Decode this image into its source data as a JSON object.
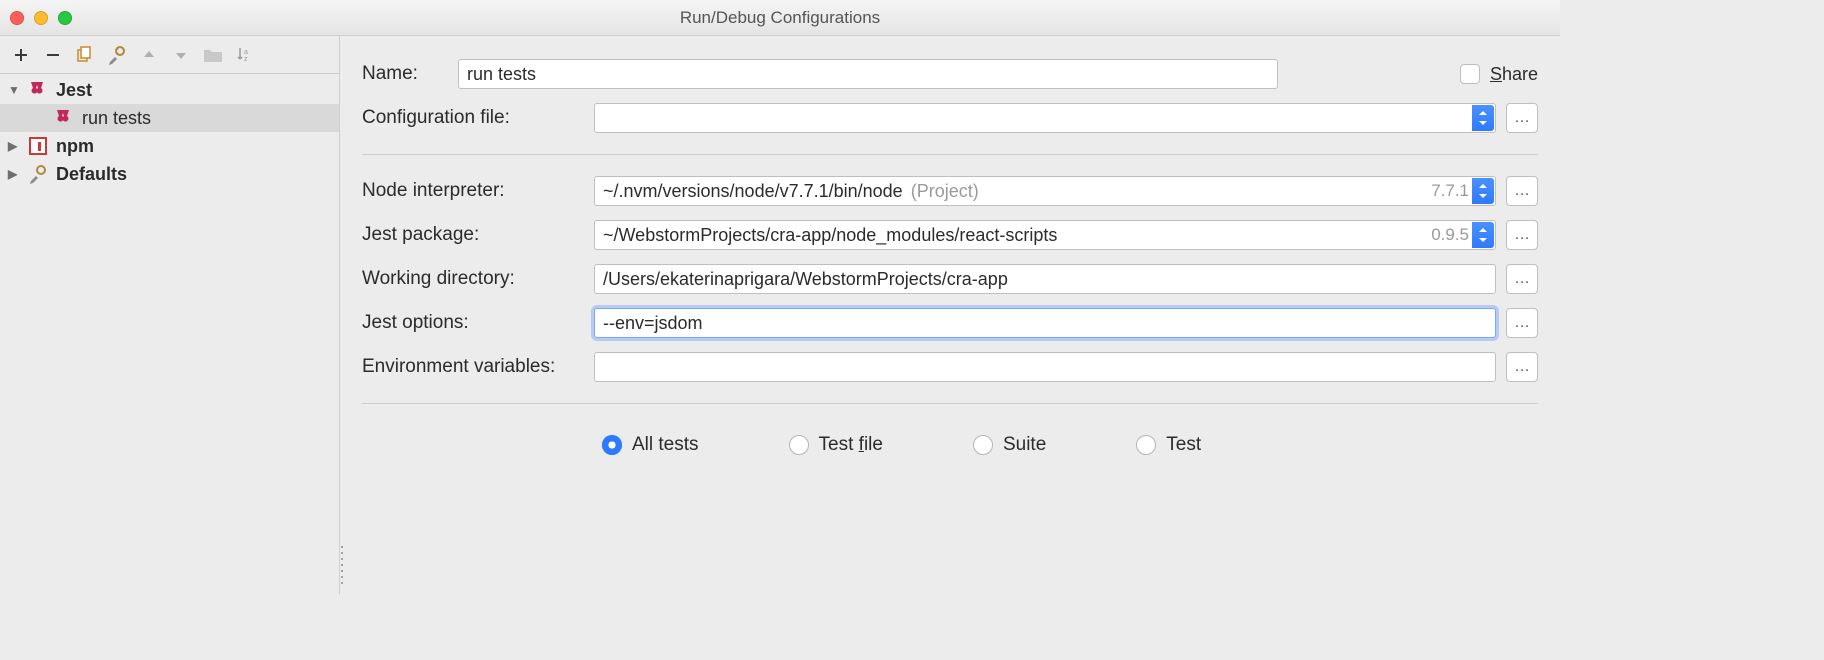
{
  "window": {
    "title": "Run/Debug Configurations"
  },
  "toolbar": {
    "items": [
      {
        "name": "add-icon",
        "kind": "plus"
      },
      {
        "name": "remove-icon",
        "kind": "minus"
      },
      {
        "name": "copy-icon",
        "kind": "copy"
      },
      {
        "name": "edit-defaults-icon",
        "kind": "wrench-gear"
      },
      {
        "name": "move-up-icon",
        "kind": "up"
      },
      {
        "name": "move-down-icon",
        "kind": "down"
      },
      {
        "name": "folder-icon",
        "kind": "folder"
      },
      {
        "name": "sort-icon",
        "kind": "sort-az"
      }
    ]
  },
  "tree": {
    "items": [
      {
        "label": "Jest",
        "icon": "jest-icon",
        "expanded": true,
        "bold": true,
        "depth": 0
      },
      {
        "label": "run tests",
        "icon": "jest-icon",
        "depth": 1,
        "selected": true
      },
      {
        "label": "npm",
        "icon": "npm-icon",
        "expanded": false,
        "bold": true,
        "depth": 0
      },
      {
        "label": "Defaults",
        "icon": "wrench-gear-icon",
        "expanded": false,
        "bold": true,
        "depth": 0
      }
    ]
  },
  "form": {
    "name_label": "Name:",
    "name_value": "run tests",
    "share_label": "Share",
    "config_file_label": "Configuration file:",
    "config_file_value": "",
    "node_interpreter_label": "Node interpreter:",
    "node_interpreter_value": "~/.nvm/versions/node/v7.7.1/bin/node",
    "node_interpreter_hint": "(Project)",
    "node_interpreter_version": "7.7.1",
    "jest_package_label": "Jest package:",
    "jest_package_value": "~/WebstormProjects/cra-app/node_modules/react-scripts",
    "jest_package_version": "0.9.5",
    "working_dir_label": "Working directory:",
    "working_dir_value": "/Users/ekaterinaprigara/WebstormProjects/cra-app",
    "jest_options_label": "Jest options:",
    "jest_options_value": "--env=jsdom",
    "env_vars_label": "Environment variables:",
    "env_vars_value": ""
  },
  "radios": {
    "options": [
      {
        "label": "All tests",
        "selected": true,
        "name": "radio-all-tests"
      },
      {
        "label": "Test file",
        "mnemonic": "f",
        "name": "radio-test-file"
      },
      {
        "label": "Suite",
        "name": "radio-suite"
      },
      {
        "label": "Test",
        "name": "radio-test"
      }
    ]
  }
}
